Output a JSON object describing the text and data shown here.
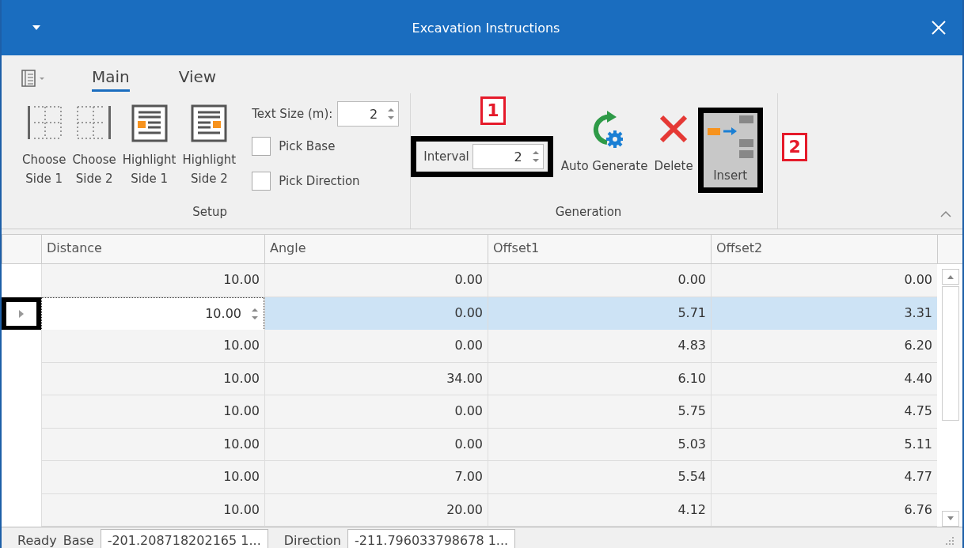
{
  "window": {
    "title": "Excavation Instructions"
  },
  "tabs": [
    {
      "label": "Main",
      "selected": true
    },
    {
      "label": "View",
      "selected": false
    }
  ],
  "ribbon": {
    "groups": [
      {
        "kind": "setup",
        "label": "Setup",
        "buttons": [
          {
            "label": "Choose\nSide 1"
          },
          {
            "label": "Choose\nSide 2"
          },
          {
            "label": "Highlight\nSide 1"
          },
          {
            "label": "Highlight\nSide 2"
          }
        ],
        "text_size": {
          "label": "Text Size (m):",
          "value": "2"
        },
        "checkboxes": [
          {
            "label": "Pick Base",
            "checked": false
          },
          {
            "label": "Pick Direction",
            "checked": false
          }
        ]
      },
      {
        "kind": "generation",
        "label": "Generation",
        "interval": {
          "label": "Interval",
          "value": "2",
          "outlined": true,
          "annotation": "1"
        },
        "buttons": [
          {
            "label": "Auto Generate",
            "outlined": false
          },
          {
            "label": "Delete",
            "outlined": false
          },
          {
            "label": "Insert",
            "outlined": true,
            "pressed": true,
            "annotation": "2"
          }
        ]
      }
    ]
  },
  "table": {
    "columns": [
      "Distance",
      "Angle",
      "Offset1",
      "Offset2"
    ],
    "rows": [
      {
        "cells": [
          "10.00",
          "0.00",
          "0.00",
          "0.00"
        ],
        "selected": false,
        "editing": false
      },
      {
        "cells": [
          "10.00",
          "0.00",
          "5.71",
          "3.31"
        ],
        "selected": true,
        "editing": true,
        "outlined": true
      },
      {
        "cells": [
          "10.00",
          "0.00",
          "4.83",
          "6.20"
        ],
        "selected": false,
        "editing": false
      },
      {
        "cells": [
          "10.00",
          "34.00",
          "6.10",
          "4.40"
        ],
        "selected": false,
        "editing": false
      },
      {
        "cells": [
          "10.00",
          "0.00",
          "5.75",
          "4.75"
        ],
        "selected": false,
        "editing": false
      },
      {
        "cells": [
          "10.00",
          "0.00",
          "5.03",
          "5.11"
        ],
        "selected": false,
        "editing": false
      },
      {
        "cells": [
          "10.00",
          "7.00",
          "5.54",
          "4.77"
        ],
        "selected": false,
        "editing": false
      },
      {
        "cells": [
          "10.00",
          "20.00",
          "4.12",
          "6.76"
        ],
        "selected": false,
        "editing": false
      }
    ]
  },
  "status_bar": {
    "status": "Ready",
    "fields": [
      {
        "label": "Base",
        "value": "-201.208718202165 1..."
      },
      {
        "label": "Direction",
        "value": "-211.796033798678 1..."
      }
    ]
  }
}
